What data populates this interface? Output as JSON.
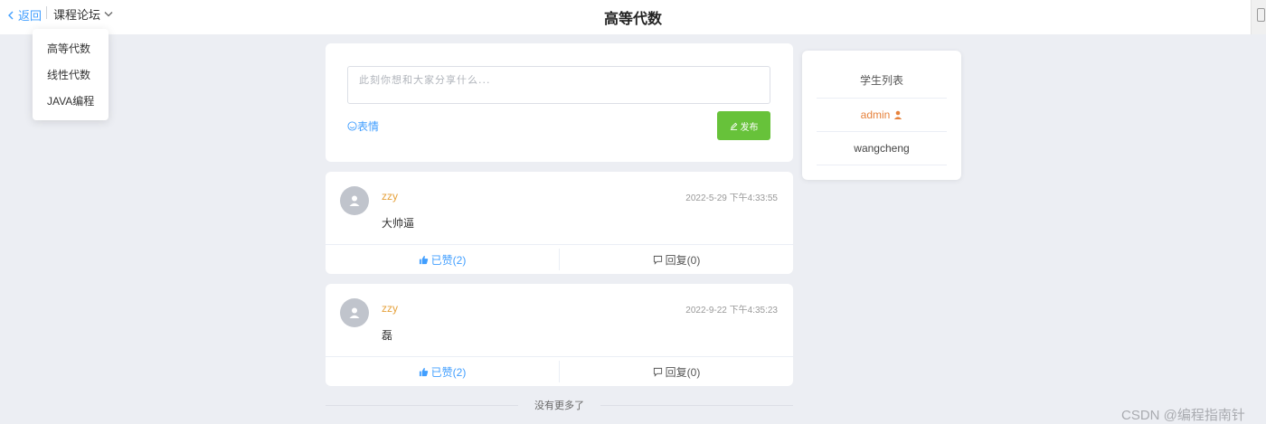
{
  "header": {
    "back_label": "返回",
    "course_label": "课程论坛",
    "title": "高等代数"
  },
  "course_menu": {
    "items": [
      "高等代数",
      "线性代数",
      "JAVA编程"
    ]
  },
  "composer": {
    "placeholder": "此刻你想和大家分享什么...",
    "emoji_label": "表情",
    "publish_label": "发布"
  },
  "posts": [
    {
      "user": "zzy",
      "time": "2022-5-29 下午4:33:55",
      "content": "大帅逼",
      "like_label": "已赞(2)",
      "reply_label": "回复(0)"
    },
    {
      "user": "zzy",
      "time": "2022-9-22 下午4:35:23",
      "content": "磊",
      "like_label": "已赞(2)",
      "reply_label": "回复(0)"
    }
  ],
  "no_more": "没有更多了",
  "students": {
    "title": "学生列表",
    "items": [
      "admin",
      "wangcheng"
    ]
  },
  "watermark": "CSDN @编程指南针",
  "colors": {
    "accent": "#409eff",
    "publish": "#67c23a",
    "username": "#e6a23c",
    "background": "#eceef3"
  }
}
